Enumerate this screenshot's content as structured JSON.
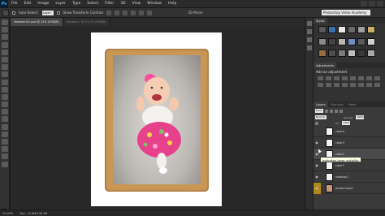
{
  "app": {
    "logo": "Ps"
  },
  "menu": [
    "File",
    "Edit",
    "Image",
    "Layer",
    "Type",
    "Select",
    "Filter",
    "3D",
    "View",
    "Window",
    "Help"
  ],
  "options": {
    "auto_select_label": "Auto-Select:",
    "auto_select_target": "Layer",
    "show_transform_label": "Show Transform Controls",
    "mode_3d_label": "3D Mode:",
    "workspace": "Photoshop Video Academy"
  },
  "tabs": [
    {
      "label": "Newborn01.psd @ 24% (RGB/8)",
      "active": true
    },
    {
      "label": "Untitled-1 @ 51.2% (RGB/8)",
      "active": false
    }
  ],
  "status": {
    "zoom": "25.09%",
    "doc": "Doc: 12.8M/136.3M"
  },
  "panels": {
    "styles_tab": "Styles",
    "adjustments_tab": "Adjustments",
    "adjustments_title": "Add an adjustment",
    "layers_tabs": [
      "Layers",
      "Channels",
      "Paths"
    ],
    "kind": "Kind",
    "mode": "Normal",
    "opacity_label": "Opacity:",
    "opacity_value": "100%",
    "fill_label": "Fill:",
    "fill_value": "100%"
  },
  "style_colors": [
    "#5a5a5a",
    "#3c6fb0",
    "#e8e8e8",
    "#6b6b6b",
    "#a0a0a0",
    "#c8b06a",
    "#8a8a8a",
    "#444444",
    "#b8b8b8",
    "#6d8fbf",
    "#5c5c5c",
    "#d0d0d0",
    "#9a6d3c",
    "#4d4d4d",
    "#7c7c7c",
    "#c0c0c0",
    "#3a3a3a",
    "#aaaaaa"
  ],
  "layers": [
    {
      "name": "color4",
      "visible": false,
      "selected": false
    },
    {
      "name": "color3",
      "visible": true,
      "selected": false
    },
    {
      "name": "color2",
      "visible": true,
      "selected": true
    },
    {
      "name": "color1",
      "visible": true,
      "selected": false
    },
    {
      "name": "shadow2",
      "visible": true,
      "selected": false
    },
    {
      "name": "photo frame",
      "visible": true,
      "selected": false
    }
  ],
  "tooltip": "Indicates layer visibility"
}
